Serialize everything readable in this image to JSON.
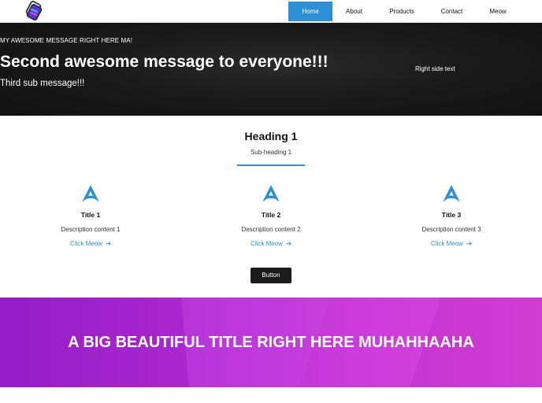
{
  "nav": {
    "links": [
      {
        "label": "Home",
        "active": true
      },
      {
        "label": "About",
        "active": false
      },
      {
        "label": "Products",
        "active": false
      },
      {
        "label": "Contact",
        "active": false
      },
      {
        "label": "Meow",
        "active": false
      }
    ]
  },
  "hero": {
    "eyebrow": "MY AWESOME MESSAGE RIGHT HERE MA!",
    "headline": "Second awesome message to everyone!!!",
    "subline": "Third sub message!!!",
    "right_text": "Right side text"
  },
  "features": {
    "heading": "Heading 1",
    "subheading": "Sub-heading 1",
    "cards": [
      {
        "title": "Title 1",
        "description": "Description content 1",
        "link": "Click Meow"
      },
      {
        "title": "Title 2",
        "description": "Description content 2",
        "link": "Click Meow"
      },
      {
        "title": "Title 3",
        "description": "Description content 3",
        "link": "Click Meow"
      }
    ],
    "button_label": "Button"
  },
  "banner": {
    "title": "A BIG BEAUTIFUL TITLE RIGHT HERE MUHAHHAAHA"
  },
  "colors": {
    "accent": "#2d8fd6",
    "hero_bg": "#161616",
    "banner_start": "#9a1fd0",
    "banner_end": "#d83fd8",
    "button_bg": "#1b1b1b"
  },
  "icons": {
    "logo": "stacked-cards-logo-icon",
    "card": "arch-triangle-icon",
    "link_arrow": "arrow-right-icon"
  }
}
